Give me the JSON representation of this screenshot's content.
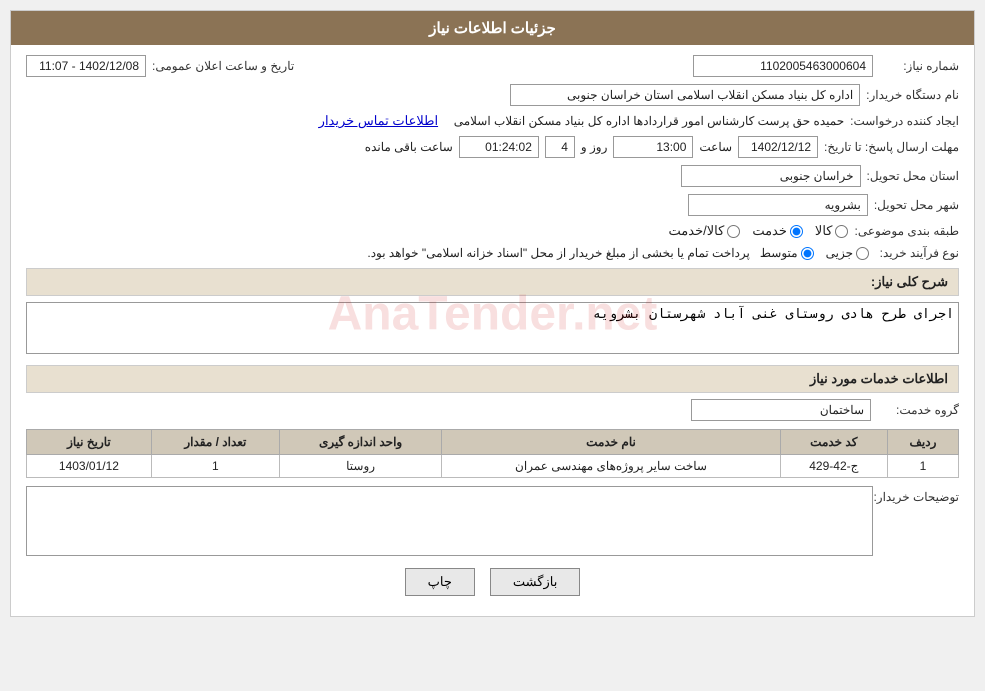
{
  "header": {
    "title": "جزئیات اطلاعات نیاز"
  },
  "fields": {
    "need_number_label": "شماره نیاز:",
    "need_number_value": "1102005463000604",
    "buyer_org_label": "نام دستگاه خریدار:",
    "buyer_org_value": "اداره کل بنیاد مسکن انقلاب اسلامی استان خراسان جنوبی",
    "creator_label": "ایجاد کننده درخواست:",
    "creator_value": "حمیده حق پرست کارشناس امور قراردادها اداره کل بنیاد مسکن انقلاب اسلامی",
    "creator_link": "اطلاعات تماس خریدار",
    "announce_date_label": "تاریخ و ساعت اعلان عمومی:",
    "announce_date_value": "1402/12/08 - 11:07",
    "deadline_label": "مهلت ارسال پاسخ: تا تاریخ:",
    "deadline_date": "1402/12/12",
    "deadline_time_label": "ساعت",
    "deadline_time": "13:00",
    "deadline_days_label": "روز و",
    "deadline_days": "4",
    "deadline_remaining_label": "ساعت باقی مانده",
    "deadline_remaining": "01:24:02",
    "province_label": "استان محل تحویل:",
    "province_value": "خراسان جنوبی",
    "city_label": "شهر محل تحویل:",
    "city_value": "بشرویه",
    "category_label": "طبقه بندی موضوعی:",
    "category_options": [
      "کالا",
      "خدمت",
      "کالا/خدمت"
    ],
    "category_selected": "خدمت",
    "procurement_label": "نوع فرآیند خرید:",
    "procurement_options": [
      "جزیی",
      "متوسط"
    ],
    "procurement_selected": "متوسط",
    "procurement_note": "پرداخت تمام یا بخشی از مبلغ خریدار از محل \"اسناد خزانه اسلامی\" خواهد بود.",
    "description_section": "شرح کلی نیاز:",
    "description_value": "اجرای طرح هادی روستای غنی آباد شهرستان بشرویه",
    "services_section": "اطلاعات خدمات مورد نیاز",
    "service_group_label": "گروه خدمت:",
    "service_group_value": "ساختمان",
    "table": {
      "headers": [
        "ردیف",
        "کد خدمت",
        "نام خدمت",
        "واحد اندازه گیری",
        "تعداد / مقدار",
        "تاریخ نیاز"
      ],
      "rows": [
        {
          "row": "1",
          "code": "ج-42-429",
          "name": "ساخت سایر پروژه‌های مهندسی عمران",
          "unit": "روستا",
          "qty": "1",
          "date": "1403/01/12"
        }
      ]
    },
    "buyer_notes_label": "توضیحات خریدار:",
    "buyer_notes_value": "",
    "btn_print": "چاپ",
    "btn_back": "بازگشت"
  }
}
